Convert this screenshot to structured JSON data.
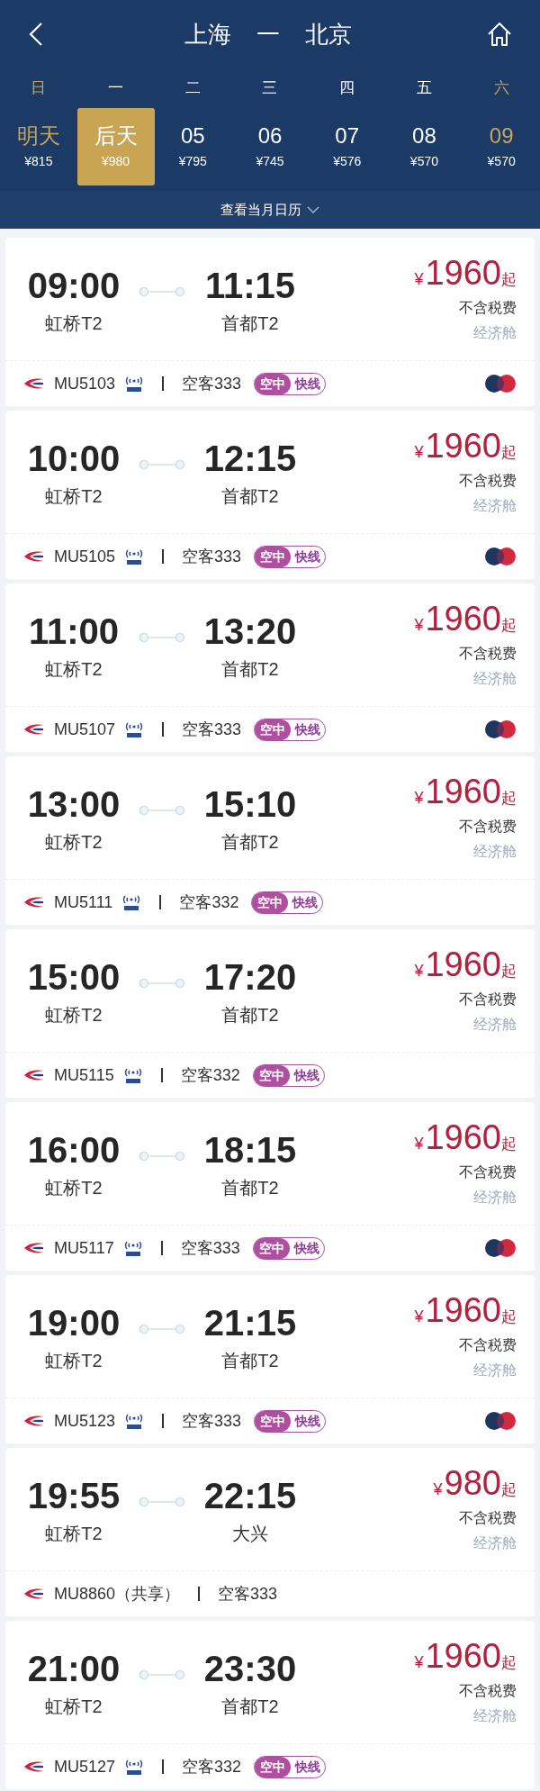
{
  "header": {
    "origin": "上海",
    "dash": "一",
    "destination": "北京"
  },
  "days": [
    {
      "weekday": "日",
      "date": "明天",
      "price": "¥815",
      "selected": false,
      "weekend": true
    },
    {
      "weekday": "一",
      "date": "后天",
      "price": "¥980",
      "selected": true,
      "weekend": false
    },
    {
      "weekday": "二",
      "date": "05",
      "price": "¥795",
      "selected": false,
      "weekend": false
    },
    {
      "weekday": "三",
      "date": "06",
      "price": "¥745",
      "selected": false,
      "weekend": false
    },
    {
      "weekday": "四",
      "date": "07",
      "price": "¥576",
      "selected": false,
      "weekend": false
    },
    {
      "weekday": "五",
      "date": "08",
      "price": "¥570",
      "selected": false,
      "weekend": false
    },
    {
      "weekday": "六",
      "date": "09",
      "price": "¥570",
      "selected": false,
      "weekend": true
    }
  ],
  "calendar_link": "查看当月日历",
  "flights": [
    {
      "depart": "09:00",
      "depart_airport": "虹桥T2",
      "arrive": "11:15",
      "arrive_airport": "首都T2",
      "currency": "¥",
      "price": "1960",
      "price_suffix": "起",
      "tax_note": "不含税费",
      "cabin": "经济舱",
      "flight_no": "MU5103",
      "wifi": true,
      "aircraft": "空客333",
      "badge": [
        "空中",
        "快线"
      ],
      "partner_logo": true
    },
    {
      "depart": "10:00",
      "depart_airport": "虹桥T2",
      "arrive": "12:15",
      "arrive_airport": "首都T2",
      "currency": "¥",
      "price": "1960",
      "price_suffix": "起",
      "tax_note": "不含税费",
      "cabin": "经济舱",
      "flight_no": "MU5105",
      "wifi": true,
      "aircraft": "空客333",
      "badge": [
        "空中",
        "快线"
      ],
      "partner_logo": true
    },
    {
      "depart": "11:00",
      "depart_airport": "虹桥T2",
      "arrive": "13:20",
      "arrive_airport": "首都T2",
      "currency": "¥",
      "price": "1960",
      "price_suffix": "起",
      "tax_note": "不含税费",
      "cabin": "经济舱",
      "flight_no": "MU5107",
      "wifi": true,
      "aircraft": "空客333",
      "badge": [
        "空中",
        "快线"
      ],
      "partner_logo": true
    },
    {
      "depart": "13:00",
      "depart_airport": "虹桥T2",
      "arrive": "15:10",
      "arrive_airport": "首都T2",
      "currency": "¥",
      "price": "1960",
      "price_suffix": "起",
      "tax_note": "不含税费",
      "cabin": "经济舱",
      "flight_no": "MU5111",
      "wifi": true,
      "aircraft": "空客332",
      "badge": [
        "空中",
        "快线"
      ],
      "partner_logo": false
    },
    {
      "depart": "15:00",
      "depart_airport": "虹桥T2",
      "arrive": "17:20",
      "arrive_airport": "首都T2",
      "currency": "¥",
      "price": "1960",
      "price_suffix": "起",
      "tax_note": "不含税费",
      "cabin": "经济舱",
      "flight_no": "MU5115",
      "wifi": true,
      "aircraft": "空客332",
      "badge": [
        "空中",
        "快线"
      ],
      "partner_logo": false
    },
    {
      "depart": "16:00",
      "depart_airport": "虹桥T2",
      "arrive": "18:15",
      "arrive_airport": "首都T2",
      "currency": "¥",
      "price": "1960",
      "price_suffix": "起",
      "tax_note": "不含税费",
      "cabin": "经济舱",
      "flight_no": "MU5117",
      "wifi": true,
      "aircraft": "空客333",
      "badge": [
        "空中",
        "快线"
      ],
      "partner_logo": true
    },
    {
      "depart": "19:00",
      "depart_airport": "虹桥T2",
      "arrive": "21:15",
      "arrive_airport": "首都T2",
      "currency": "¥",
      "price": "1960",
      "price_suffix": "起",
      "tax_note": "不含税费",
      "cabin": "经济舱",
      "flight_no": "MU5123",
      "wifi": true,
      "aircraft": "空客333",
      "badge": [
        "空中",
        "快线"
      ],
      "partner_logo": true
    },
    {
      "depart": "19:55",
      "depart_airport": "虹桥T2",
      "arrive": "22:15",
      "arrive_airport": "大兴",
      "currency": "¥",
      "price": "980",
      "price_suffix": "起",
      "tax_note": "不含税费",
      "cabin": "经济舱",
      "flight_no": "MU8860（共享）",
      "wifi": false,
      "aircraft": "空客333",
      "partner_logo": false
    },
    {
      "depart": "21:00",
      "depart_airport": "虹桥T2",
      "arrive": "23:30",
      "arrive_airport": "首都T2",
      "currency": "¥",
      "price": "1960",
      "price_suffix": "起",
      "tax_note": "不含税费",
      "cabin": "经济舱",
      "flight_no": "MU5127",
      "wifi": true,
      "aircraft": "空客332",
      "badge": [
        "空中",
        "快线"
      ],
      "partner_logo": false
    }
  ]
}
